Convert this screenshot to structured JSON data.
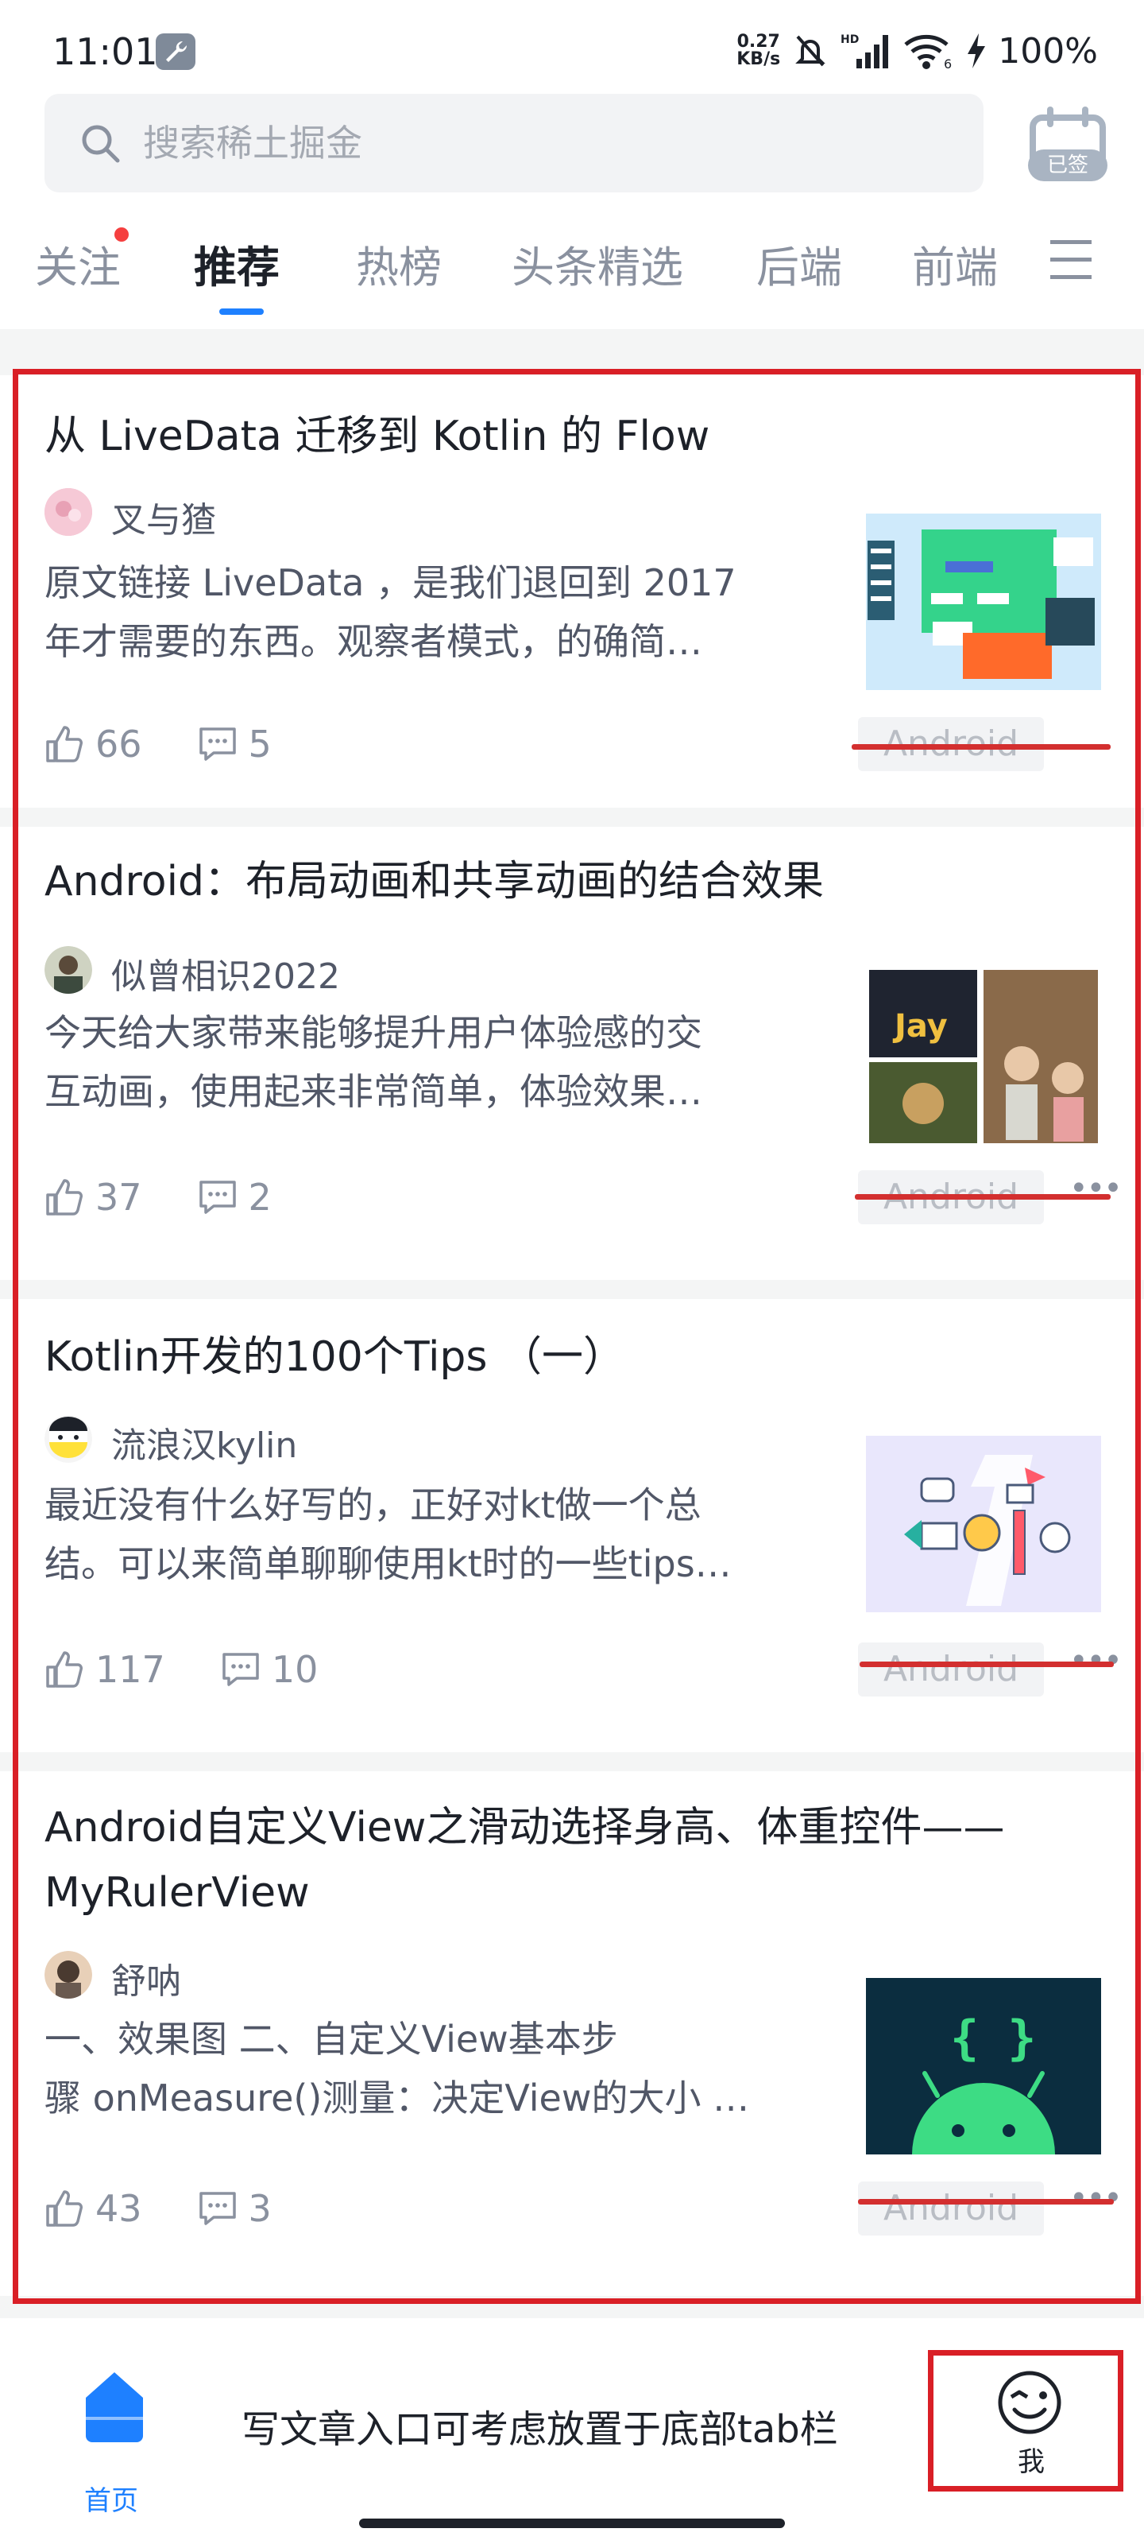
{
  "status_bar": {
    "time": "11:01",
    "net_speed_value": "0.27",
    "net_speed_unit": "KB/s",
    "signal_label": "HD",
    "wifi_label": "6",
    "battery": "100%"
  },
  "header": {
    "search_placeholder": "搜索稀土掘金",
    "checkin_label": "已签"
  },
  "tabs": [
    {
      "label": "关注",
      "has_dot": true
    },
    {
      "label": "推荐",
      "active": true
    },
    {
      "label": "热榜"
    },
    {
      "label": "头条精选"
    },
    {
      "label": "后端"
    },
    {
      "label": "前端"
    }
  ],
  "feed": [
    {
      "title": "从 LiveData 迁移到 Kotlin 的 Flow",
      "author": "叉与猹",
      "summary_line1": "原文链接 LiveData ，是我们退回到 2017",
      "summary_line2": "年才需要的东西。观察者模式，的确简…",
      "likes": "66",
      "comments": "5",
      "tag": "Android"
    },
    {
      "title": "Android：布局动画和共享动画的结合效果",
      "author": "似曾相识2022",
      "summary_line1": "今天给大家带来能够提升用户体验感的交",
      "summary_line2": "互动画，使用起来非常简单，体验效果…",
      "likes": "37",
      "comments": "2",
      "tag": "Android",
      "thumb_text": "Jay"
    },
    {
      "title": "Kotlin开发的100个Tips （一）",
      "author": "流浪汉kylin",
      "summary_line1": "最近没有什么好写的，正好对kt做一个总",
      "summary_line2": "结。可以来简单聊聊使用kt时的一些tips…",
      "likes": "117",
      "comments": "10",
      "tag": "Android"
    },
    {
      "title_line1": "Android自定义View之滑动选择身高、体重控件——",
      "title_line2": "MyRulerView",
      "author": "舒呐",
      "summary_line1": "一、效果图  二、自定义View基本步",
      "summary_line2": "骤 onMeasure()测量：决定View的大小 …",
      "likes": "43",
      "comments": "3",
      "tag": "Android",
      "thumb_text": "{ }"
    }
  ],
  "bottom_nav": {
    "home_label": "首页",
    "annotation_note": "写文章入口可考虑放置于底部tab栏",
    "me_label": "我"
  },
  "colors": {
    "accent": "#1e80ff",
    "annotation": "#d91f26",
    "text_primary": "#1d2129",
    "text_secondary": "#515767",
    "text_muted": "#8a919f"
  }
}
